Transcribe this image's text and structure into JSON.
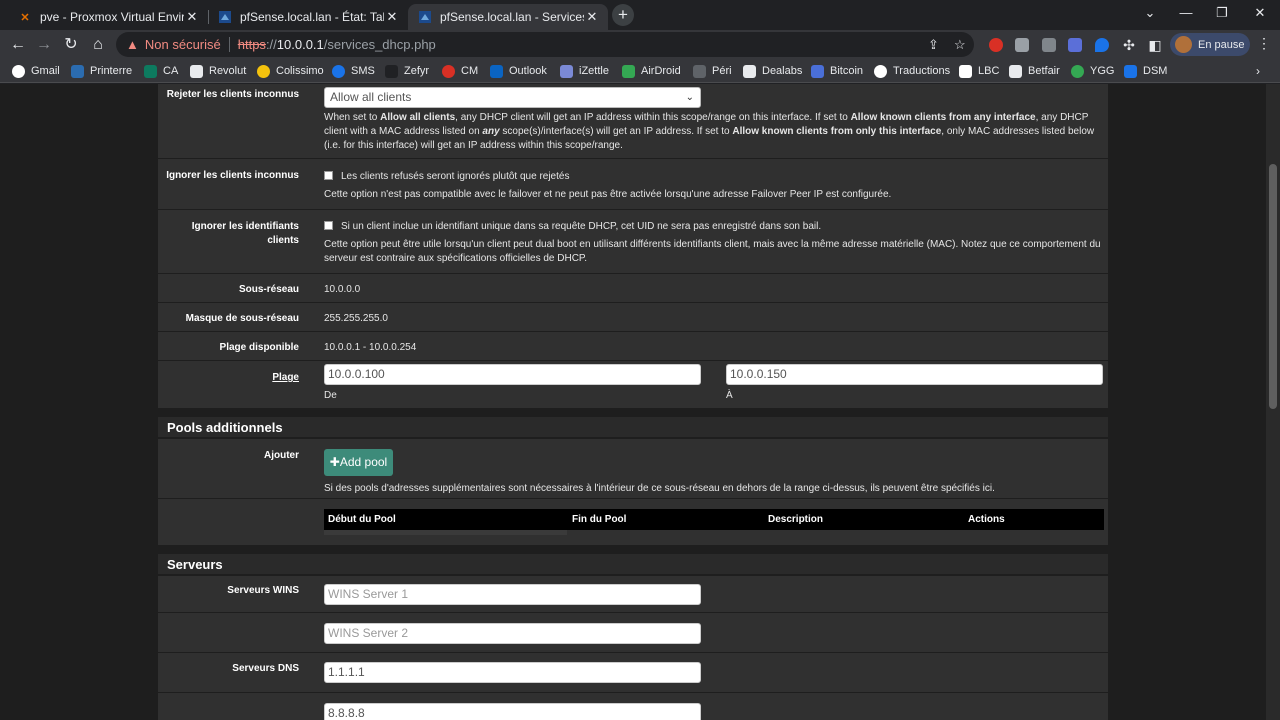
{
  "browser": {
    "tabs": [
      {
        "title": "pve - Proxmox Virtual Environment",
        "favicon": "proxmox-icon",
        "active": false
      },
      {
        "title": "pfSense.local.lan - État: Tableau de bord",
        "favicon": "pfsense-icon",
        "active": false
      },
      {
        "title": "pfSense.local.lan - Services: Serveur DHCP",
        "favicon": "pfsense-icon",
        "active": true
      }
    ],
    "security_label": "Non sécurisé",
    "url_scheme": "https",
    "url_sep": "://",
    "url_host": "10.0.0.1",
    "url_path": "/services_dhcp.php",
    "profile_label": "En pause",
    "bookmarks": [
      "Gmail",
      "Printerre",
      "CA",
      "Revolut",
      "Colissimo",
      "SMS",
      "Zefyr",
      "CM",
      "Outlook",
      "iZettle",
      "AirDroid",
      "Péri",
      "Dealabs",
      "Bitcoin",
      "Traductions",
      "LBC",
      "Betfair",
      "YGG",
      "DSM"
    ]
  },
  "general": {
    "deny_unknown": {
      "label": "Rejeter les clients inconnus",
      "select_value": "Allow all clients",
      "help_1": "When set to ",
      "help_b1": "Allow all clients",
      "help_2": ", any DHCP client will get an IP address within this scope/range on this interface. If set to ",
      "help_b2": "Allow known clients from any interface",
      "help_3": ", any DHCP client with a MAC address listed on ",
      "help_b3": "any",
      "help_4": " scope(s)/interface(s) will get an IP address. If set to ",
      "help_b4": "Allow known clients from only this interface",
      "help_5": ", only MAC addresses listed below (i.e. for this interface) will get an IP address within this scope/range."
    },
    "ignore_denied": {
      "label": "Ignorer les clients inconnus",
      "checkbox_text": "Les clients refusés seront ignorés plutôt que rejetés",
      "help": "Cette option n'est pas compatible avec le failover et ne peut pas être activée lorsqu'une adresse Failover Peer IP est configurée."
    },
    "ignore_uid": {
      "label": "Ignorer les identifiants clients",
      "checkbox_text": "Si un client inclue un identifiant unique dans sa requête DHCP, cet UID ne sera pas enregistré dans son bail.",
      "help": "Cette option peut être utile lorsqu'un client peut dual boot en utilisant différents identifiants client, mais avec la même adresse matérielle (MAC). Notez que ce comportement du serveur est contraire aux spécifications officielles de DHCP."
    },
    "subnet": {
      "label": "Sous-réseau",
      "value": "10.0.0.0"
    },
    "mask": {
      "label": "Masque de sous-réseau",
      "value": "255.255.255.0"
    },
    "available_range": {
      "label": "Plage disponible",
      "value": "10.0.0.1 - 10.0.0.254"
    },
    "range": {
      "label": "Plage",
      "from": "10.0.0.100",
      "from_caption": "De",
      "to": "10.0.0.150",
      "to_caption": "À"
    }
  },
  "pools": {
    "heading": "Pools additionnels",
    "add_label": "Ajouter",
    "add_button": "Add pool",
    "help": "Si des pools d'adresses supplémentaires sont nécessaires à l'intérieur de ce sous-réseau en dehors de la range ci-dessus, ils peuvent être spécifiés ici.",
    "columns": [
      "Début du Pool",
      "Fin du Pool",
      "Description",
      "Actions"
    ]
  },
  "servers": {
    "heading": "Serveurs",
    "wins_label": "Serveurs WINS",
    "wins1_placeholder": "WINS Server 1",
    "wins2_placeholder": "WINS Server 2",
    "dns_label": "Serveurs DNS",
    "dns1": "1.1.1.1",
    "dns2": "8.8.8.8"
  },
  "colors": {
    "page_bg": "#1e1e1e",
    "panel_bg": "#303030",
    "accent": "#3d8b7a",
    "warning": "#f28b82"
  }
}
